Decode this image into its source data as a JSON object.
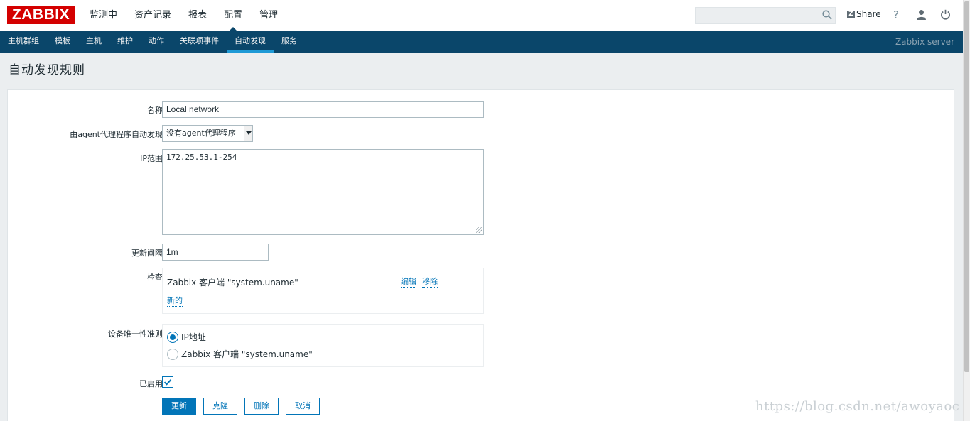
{
  "brand": {
    "logo_text": "ZABBIX",
    "color": "#d40000"
  },
  "main_nav": [
    {
      "label": "监测中"
    },
    {
      "label": "资产记录"
    },
    {
      "label": "报表"
    },
    {
      "label": "配置",
      "selected": true
    },
    {
      "label": "管理"
    }
  ],
  "header": {
    "share_label": "Share",
    "help_label": "?"
  },
  "sub_nav": [
    {
      "label": "主机群组"
    },
    {
      "label": "模板"
    },
    {
      "label": "主机"
    },
    {
      "label": "维护"
    },
    {
      "label": "动作"
    },
    {
      "label": "关联项事件"
    },
    {
      "label": "自动发现",
      "selected": true
    },
    {
      "label": "服务"
    }
  ],
  "server_name": "Zabbix server",
  "page_title": "自动发现规则",
  "form": {
    "name_label": "名称",
    "name_value": "Local network",
    "proxy_label": "由agent代理程序自动发现",
    "proxy_value": "没有agent代理程序",
    "ip_range_label": "IP范围",
    "ip_range_value": "172.25.53.1-254",
    "interval_label": "更新间隔",
    "interval_value": "1m",
    "checks_label": "检查",
    "check_item": "Zabbix 客户端 \"system.uname\"",
    "check_edit": "编辑",
    "check_remove": "移除",
    "check_new": "新的",
    "uniqueness_label": "设备唯一性准则",
    "uniqueness_options": [
      {
        "label": "IP地址",
        "checked": true
      },
      {
        "label": "Zabbix 客户端 \"system.uname\"",
        "checked": false
      }
    ],
    "enabled_label": "已启用",
    "enabled": true
  },
  "buttons": {
    "update": "更新",
    "clone": "克隆",
    "delete": "删除",
    "cancel": "取消"
  },
  "watermark": "https://blog.csdn.net/awoyaoc"
}
